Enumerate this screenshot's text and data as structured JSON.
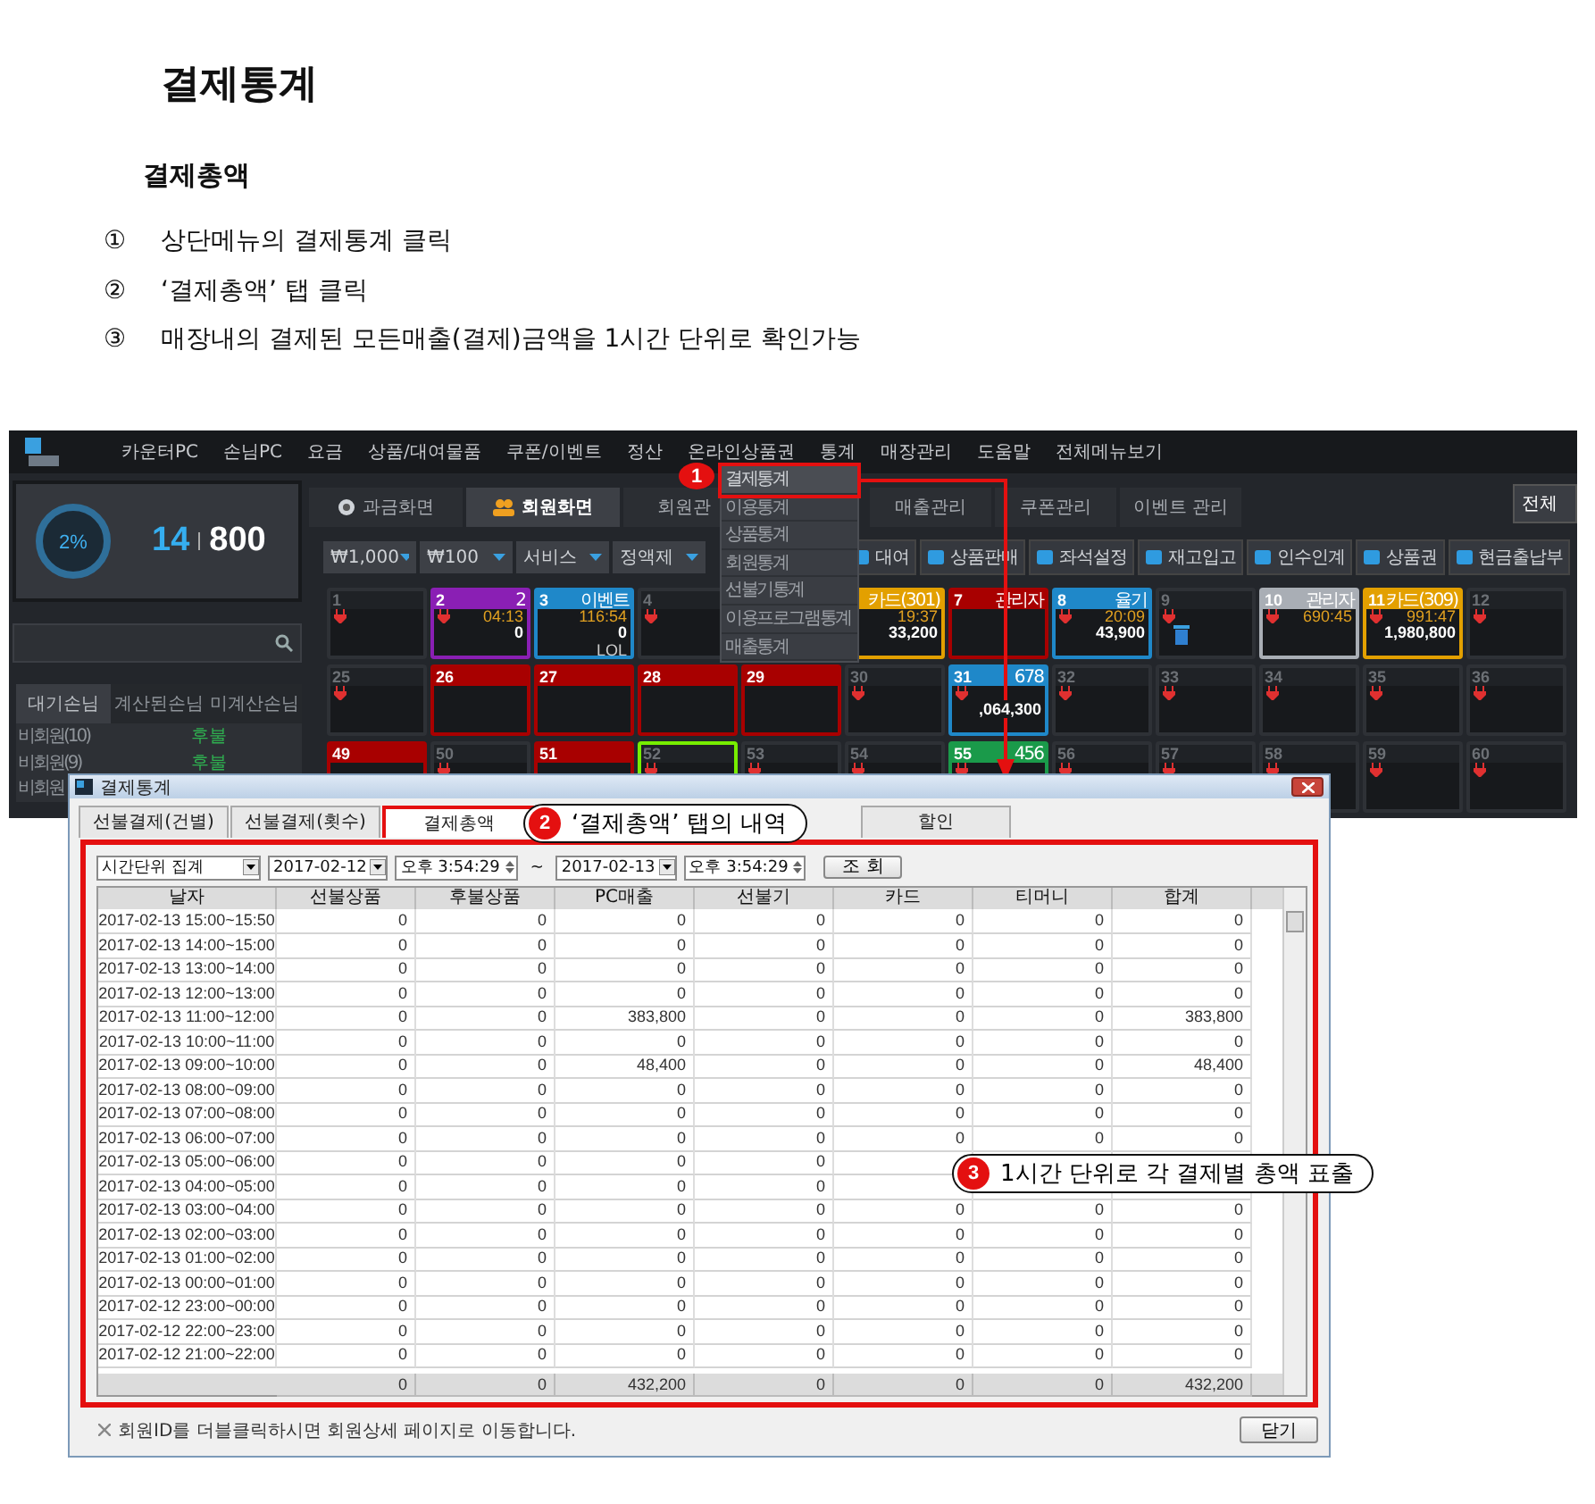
{
  "doc": {
    "title": "결제통계",
    "subtitle": "결제총액",
    "steps": [
      {
        "marker": "①",
        "text": "상단메뉴의 결제통계 클릭"
      },
      {
        "marker": "②",
        "text": "‘결제총액’ 탭 클릭"
      },
      {
        "marker": "③",
        "text": "매장내의 결제된 모든매출(결제)금액을  1시간 단위로 확인가능"
      }
    ]
  },
  "app": {
    "menu": [
      "카운터PC",
      "손님PC",
      "요금",
      "상품/대여물품",
      "쿠폰/이벤트",
      "정산",
      "온라인상품권",
      "통계",
      "매장관리",
      "도움말",
      "전체메뉴보기"
    ],
    "usage": {
      "percent": "2%",
      "current": "14",
      "total": "800"
    },
    "customer_tabs": [
      {
        "label": "대기손님",
        "selected": true
      },
      {
        "label": "계산된손님",
        "selected": false
      },
      {
        "label": "미계산손님",
        "selected": false
      }
    ],
    "customers": [
      {
        "name": "비회원(10)",
        "status": "후불"
      },
      {
        "name": "비회원(9)",
        "status": "후불"
      },
      {
        "name": "비회원"
      }
    ],
    "tabs": [
      {
        "label": "과금화면",
        "kind": "charge",
        "selected": false
      },
      {
        "label": "회원화면",
        "kind": "member",
        "selected": true
      },
      {
        "label": "회원관",
        "kind": "text",
        "selected": false
      },
      {
        "kind": "covered"
      },
      {
        "label": "매출관리",
        "kind": "text",
        "selected": false
      },
      {
        "label": "쿠폰관리",
        "kind": "text",
        "selected": false
      },
      {
        "label": "이벤트 관리",
        "kind": "text",
        "selected": false
      }
    ],
    "all_button": "전체",
    "filters": [
      "₩1,000",
      "₩100",
      "서비스",
      "정액제"
    ],
    "tools": [
      "대여",
      "상품판매",
      "좌석설정",
      "재고입고",
      "인수인계",
      "상품권",
      "현금출납부"
    ],
    "seat_rows": [
      [
        {
          "kind": "plain",
          "number": "1",
          "plug": true
        },
        {
          "kind": "colored",
          "number": "2",
          "label": "2",
          "color": "#8a1fb4",
          "plug": true,
          "time": "04:13",
          "amount": "0"
        },
        {
          "kind": "colored",
          "number": "3",
          "label": "이벤트",
          "color": "#1f88c9",
          "time": "116:54",
          "amount": "0",
          "extra": "LOL"
        },
        {
          "kind": "plain",
          "number": "4",
          "plug": true
        },
        {
          "kind": "covered"
        },
        {
          "kind": "colored",
          "label": "카드(301)",
          "color": "#e3a000",
          "time": "19:37",
          "amount": "33,200"
        },
        {
          "kind": "colored",
          "number": "7",
          "label": "관리자",
          "color": "#a80000"
        },
        {
          "kind": "colored",
          "number": "8",
          "label": "율기",
          "color": "#1f88c9",
          "plug": true,
          "time": "20:09",
          "amount": "43,900"
        },
        {
          "kind": "plain",
          "number": "9",
          "plug": true,
          "trash": true
        },
        {
          "kind": "colored",
          "number": "10",
          "label": "관리자",
          "color": "#a9aeb5",
          "plug": true,
          "time": "690:45"
        },
        {
          "kind": "colored",
          "number": "11",
          "label": "카드(309)",
          "color": "#e3a000",
          "plug": true,
          "time": "991:47",
          "amount": "1,980,800"
        },
        {
          "kind": "plain",
          "number": "12",
          "plug": true
        }
      ],
      [
        {
          "kind": "plain",
          "number": "25",
          "plug": true
        },
        {
          "kind": "colored",
          "number": "26",
          "color": "#a80000"
        },
        {
          "kind": "colored",
          "number": "27",
          "color": "#a80000"
        },
        {
          "kind": "colored",
          "number": "28",
          "color": "#a80000"
        },
        {
          "kind": "colored",
          "number": "29",
          "color": "#a80000"
        },
        {
          "kind": "plain",
          "number": "30",
          "plug": true
        },
        {
          "kind": "colored",
          "number": "31",
          "label": "678",
          "color": "#1f88c9",
          "plug": true,
          "amount": ",064,300"
        },
        {
          "kind": "plain",
          "number": "32",
          "plug": true
        },
        {
          "kind": "plain",
          "number": "33",
          "plug": true
        },
        {
          "kind": "plain",
          "number": "34",
          "plug": true
        },
        {
          "kind": "plain",
          "number": "35",
          "plug": true
        },
        {
          "kind": "plain",
          "number": "36",
          "plug": true
        }
      ],
      [
        {
          "kind": "colored",
          "number": "49",
          "color": "#a80000"
        },
        {
          "kind": "plain",
          "number": "50",
          "plug": true
        },
        {
          "kind": "colored",
          "number": "51",
          "color": "#a80000"
        },
        {
          "kind": "outlined",
          "number": "52",
          "color": "#77ee00",
          "plug": true
        },
        {
          "kind": "plain",
          "number": "53",
          "plug": true
        },
        {
          "kind": "plain",
          "number": "54",
          "plug": true
        },
        {
          "kind": "colored",
          "number": "55",
          "label": "456",
          "color": "#1a9a4a",
          "plug": true
        },
        {
          "kind": "plain",
          "number": "56",
          "plug": true
        },
        {
          "kind": "plain",
          "number": "57",
          "plug": true
        },
        {
          "kind": "plain",
          "number": "58",
          "plug": true
        },
        {
          "kind": "plain",
          "number": "59",
          "plug": true
        },
        {
          "kind": "plain",
          "number": "60",
          "plug": true
        }
      ]
    ],
    "stats_menu": [
      {
        "label": "결제통계",
        "selected": true
      },
      {
        "label": "이용통계",
        "selected": false
      },
      {
        "label": "상품통계",
        "selected": false
      },
      {
        "label": "회원통계",
        "selected": false
      },
      {
        "label": "선불기통계",
        "selected": false
      },
      {
        "label": "이용프로그램통계",
        "selected": false
      },
      {
        "label": "매출통계",
        "selected": false
      }
    ]
  },
  "dialog": {
    "title": "결제통계",
    "tabs": [
      {
        "label": "선불결제(건별)",
        "kind": "tab",
        "selected": false
      },
      {
        "label": "선불결제(횟수)",
        "kind": "tab",
        "selected": false
      },
      {
        "label": "결제총액",
        "kind": "tab",
        "selected": true
      },
      {
        "kind": "covered"
      },
      {
        "label": "할인",
        "kind": "tab",
        "selected": false
      }
    ],
    "filter": {
      "mode": "시간단위 집계",
      "from_date": "2017-02-12",
      "from_time": "오후 3:54:29",
      "separator": "~",
      "to_date": "2017-02-13",
      "to_time": "오후 3:54:29",
      "search_button": "조  회"
    },
    "table": {
      "columns": [
        "날자",
        "선불상품",
        "후불상품",
        "PC매출",
        "선불기",
        "카드",
        "티머니",
        "합계"
      ],
      "rows": [
        [
          "2017-02-13 15:00~15:50",
          "0",
          "0",
          "0",
          "0",
          "0",
          "0",
          "0"
        ],
        [
          "2017-02-13 14:00~15:00",
          "0",
          "0",
          "0",
          "0",
          "0",
          "0",
          "0"
        ],
        [
          "2017-02-13 13:00~14:00",
          "0",
          "0",
          "0",
          "0",
          "0",
          "0",
          "0"
        ],
        [
          "2017-02-13 12:00~13:00",
          "0",
          "0",
          "0",
          "0",
          "0",
          "0",
          "0"
        ],
        [
          "2017-02-13 11:00~12:00",
          "0",
          "0",
          "383,800",
          "0",
          "0",
          "0",
          "383,800"
        ],
        [
          "2017-02-13 10:00~11:00",
          "0",
          "0",
          "0",
          "0",
          "0",
          "0",
          "0"
        ],
        [
          "2017-02-13 09:00~10:00",
          "0",
          "0",
          "48,400",
          "0",
          "0",
          "0",
          "48,400"
        ],
        [
          "2017-02-13 08:00~09:00",
          "0",
          "0",
          "0",
          "0",
          "0",
          "0",
          "0"
        ],
        [
          "2017-02-13 07:00~08:00",
          "0",
          "0",
          "0",
          "0",
          "0",
          "0",
          "0"
        ],
        [
          "2017-02-13 06:00~07:00",
          "0",
          "0",
          "0",
          "0",
          "0",
          "0",
          "0"
        ],
        [
          "2017-02-13 05:00~06:00",
          "0",
          "0",
          "0",
          "0"
        ],
        [
          "2017-02-13 04:00~05:00",
          "0",
          "0",
          "0",
          "0"
        ],
        [
          "2017-02-13 03:00~04:00",
          "0",
          "0",
          "0",
          "0",
          "0",
          "0",
          "0"
        ],
        [
          "2017-02-13 02:00~03:00",
          "0",
          "0",
          "0",
          "0",
          "0",
          "0",
          "0"
        ],
        [
          "2017-02-13 01:00~02:00",
          "0",
          "0",
          "0",
          "0",
          "0",
          "0",
          "0"
        ],
        [
          "2017-02-13 00:00~01:00",
          "0",
          "0",
          "0",
          "0",
          "0",
          "0",
          "0"
        ],
        [
          "2017-02-12 23:00~00:00",
          "0",
          "0",
          "0",
          "0",
          "0",
          "0",
          "0"
        ],
        [
          "2017-02-12 22:00~23:00",
          "0",
          "0",
          "0",
          "0",
          "0",
          "0",
          "0"
        ],
        [
          "2017-02-12 21:00~22:00",
          "0",
          "0",
          "0",
          "0",
          "0",
          "0",
          "0"
        ]
      ],
      "totals": [
        "0",
        "0",
        "432,200",
        "0",
        "0",
        "0",
        "432,200"
      ]
    },
    "note": "회원ID를 더블클릭하시면 회원상세 페이지로 이동합니다.",
    "close_button": "닫기"
  },
  "callouts": [
    {
      "number": "1"
    },
    {
      "number": "2",
      "text": "‘결제총액’ 탭의 내역"
    },
    {
      "number": "3",
      "text": "1시간 단위로 각 결제별 총액 표출"
    }
  ]
}
